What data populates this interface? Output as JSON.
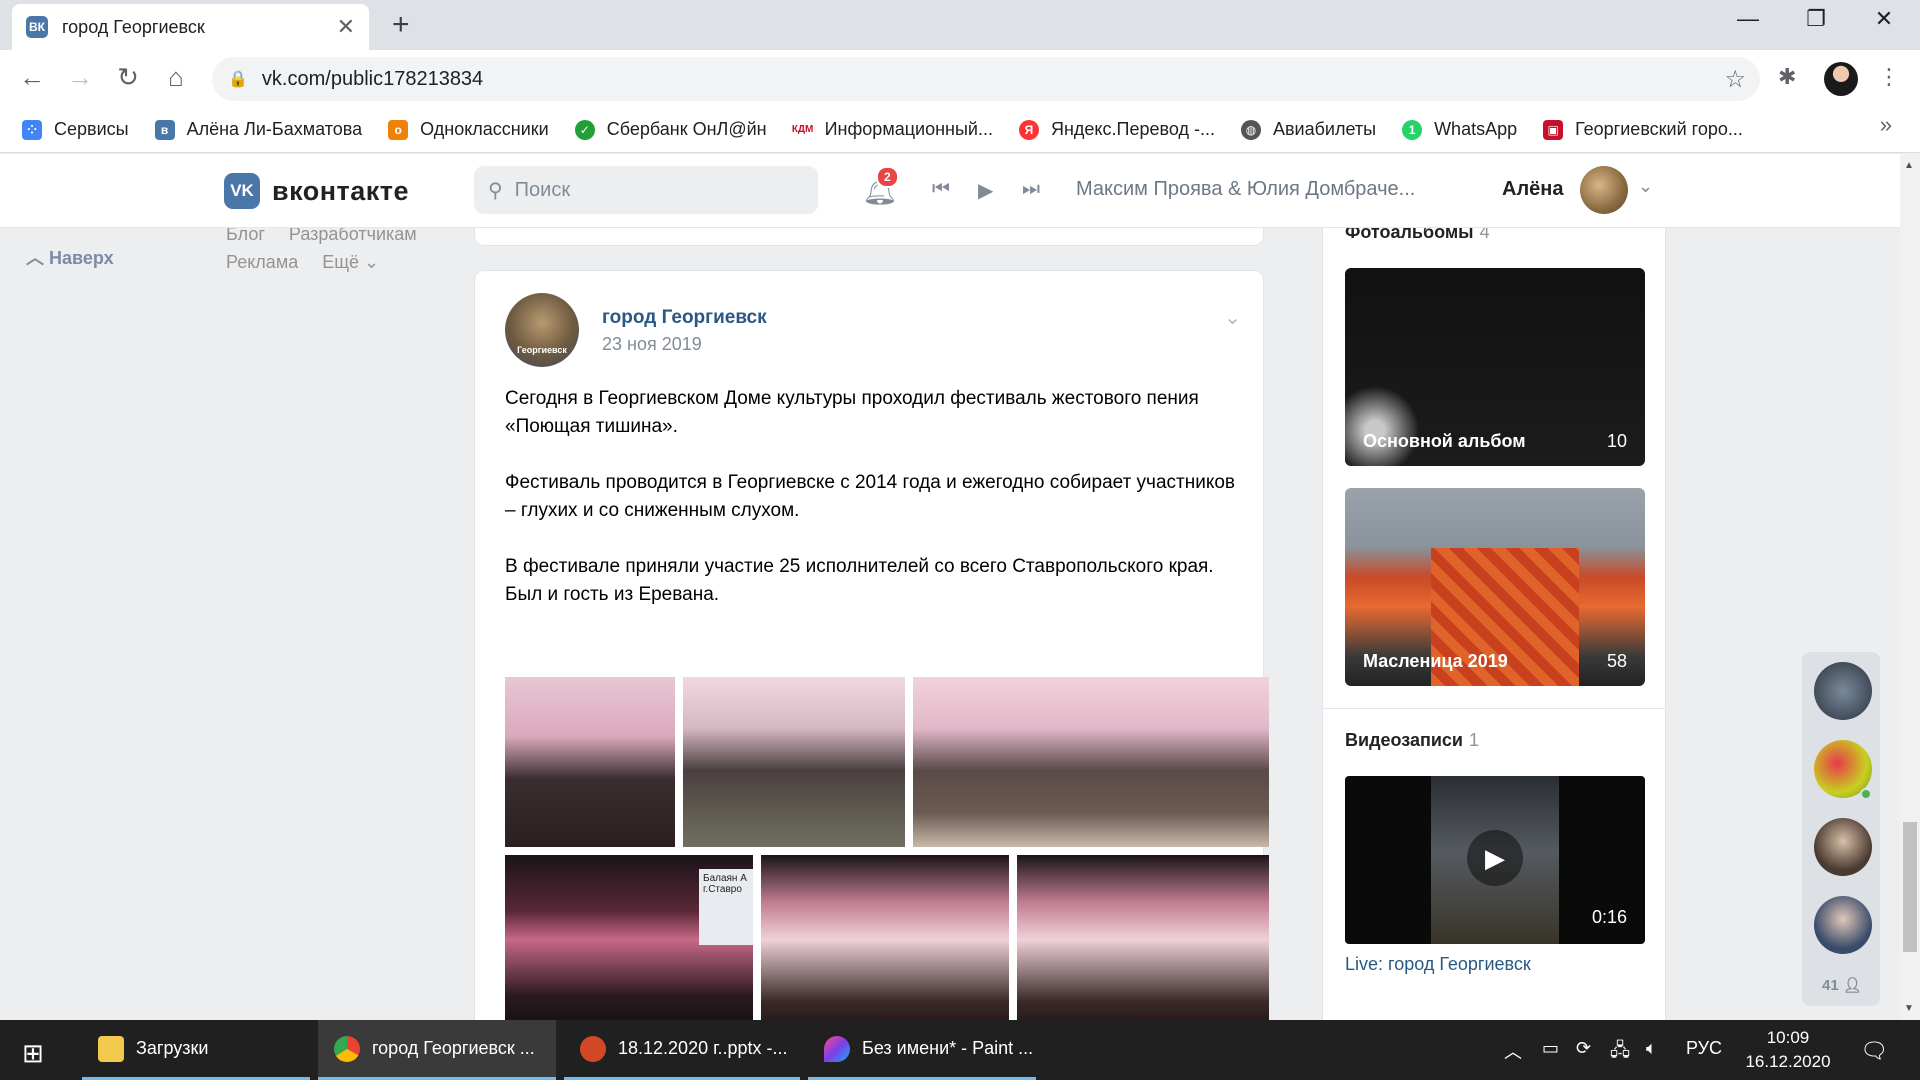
{
  "browser": {
    "tab_title": "город Георгиевск",
    "tab_icon": "ВК",
    "url": "vk.com/public178213834",
    "bookmarks": [
      {
        "label": "Сервисы",
        "color": "#4285f4",
        "icon": "apps-grid-icon"
      },
      {
        "label": "Алёна Ли-Бахматова",
        "color": "#4a76a8",
        "icon": "vk-icon"
      },
      {
        "label": "Одноклассники",
        "color": "#ee8208",
        "icon": "ok-icon"
      },
      {
        "label": "Сбербанк ОнЛ@йн",
        "color": "#21a038",
        "icon": "sber-icon"
      },
      {
        "label": "Информационный...",
        "color": "#c8102e",
        "icon": "kdm-icon"
      },
      {
        "label": "Яндекс.Перевод -...",
        "color": "#ff3333",
        "icon": "yandex-translate-icon"
      },
      {
        "label": "Авиабилеты",
        "color": "#555555",
        "icon": "globe-icon"
      },
      {
        "label": "WhatsApp",
        "color": "#25d366",
        "icon": "whatsapp-icon"
      },
      {
        "label": "Георгиевский горо...",
        "color": "#c8102e",
        "icon": "city-icon"
      }
    ]
  },
  "vk": {
    "logo_text": "вконтакте",
    "logo_mark": "VK",
    "search_placeholder": "Поиск",
    "notif_count": "2",
    "now_playing": "Максим Проява & Юлия Домбраче...",
    "user_name": "Алёна",
    "left_links": [
      "Блог",
      "Разработчикам",
      "Реклама",
      "Ещё ⌄"
    ],
    "up_label": "Наверх"
  },
  "post": {
    "author": "город Георгиевск",
    "avatar_label": "Георгиевск",
    "date": "23 ноя 2019",
    "paragraphs": [
      "Сегодня в Георгиевском Доме культуры проходил фестиваль жестового пения «Поющая тишина».",
      "Фестиваль проводится в Георгиевске с 2014 года и ежегодно собирает участников – глухих и со сниженным слухом.",
      "В фестивале приняли участие 25 исполнителей со всего Ставропольского края. Был и гость из Еревана."
    ],
    "screen_text": "Балаян А г.Ставро"
  },
  "sidebar": {
    "albums_title": "Фотоальбомы",
    "albums_count": "4",
    "albums": [
      {
        "name": "Основной альбом",
        "count": "10"
      },
      {
        "name": "Масленица 2019",
        "count": "58"
      }
    ],
    "videos_title": "Видеозаписи",
    "videos_count": "1",
    "video_duration": "0:16",
    "video_link": "Live: город Георгиевск"
  },
  "chats": {
    "count": "41"
  },
  "taskbar": {
    "items": [
      {
        "label": "Загрузки",
        "color": "#f2c94c"
      },
      {
        "label": "город Георгиевск ...",
        "color": "#4285f4"
      },
      {
        "label": "18.12.2020 г..pptx -...",
        "color": "#d24726"
      },
      {
        "label": "Без имени* - Paint ...",
        "color": "#7b3fe4"
      }
    ],
    "lang": "РУС",
    "time": "10:09",
    "date": "16.12.2020"
  }
}
